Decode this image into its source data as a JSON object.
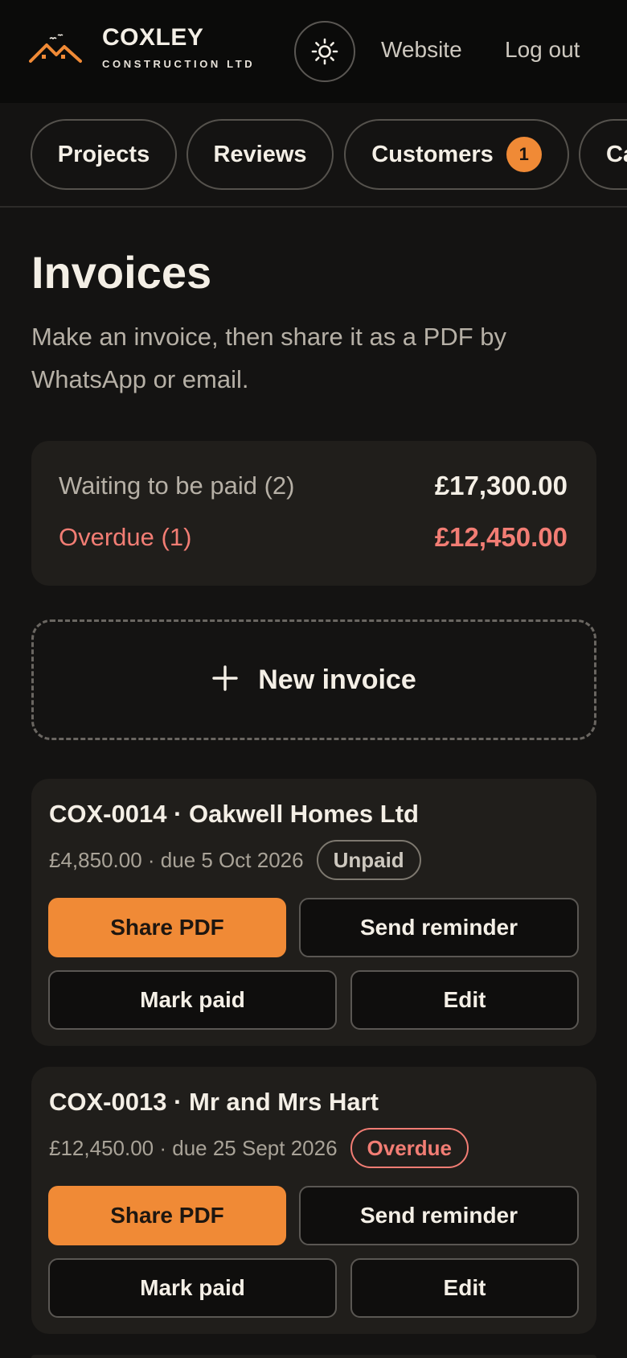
{
  "brand": {
    "name": "COXLEY",
    "tagline": "CONSTRUCTION LTD"
  },
  "header": {
    "theme_icon": "sun-icon",
    "website_label": "Website",
    "logout_label": "Log out"
  },
  "tabs": [
    {
      "label": "Projects"
    },
    {
      "label": "Reviews"
    },
    {
      "label": "Customers",
      "badge": "1"
    },
    {
      "label": "Ca"
    }
  ],
  "page": {
    "title": "Invoices",
    "subtitle": "Make an invoice, then share it as a PDF by WhatsApp or email."
  },
  "summary": {
    "waiting_label": "Waiting to be paid (2)",
    "waiting_value": "£17,300.00",
    "overdue_label": "Overdue (1)",
    "overdue_value": "£12,450.00"
  },
  "new_invoice_label": "New invoice",
  "invoices": [
    {
      "title": "COX-0014 · Oakwell Homes Ltd",
      "meta": "£4,850.00 · due 5 Oct 2026",
      "status": "Unpaid",
      "share_label": "Share PDF",
      "reminder_label": "Send reminder",
      "mark_paid_label": "Mark paid",
      "edit_label": "Edit"
    },
    {
      "title": "COX-0013 · Mr and Mrs Hart",
      "meta": "£12,450.00 · due 25 Sept 2026",
      "status": "Overdue",
      "share_label": "Share PDF",
      "reminder_label": "Send reminder",
      "mark_paid_label": "Mark paid",
      "edit_label": "Edit"
    }
  ],
  "colors": {
    "accent": "#f08a36",
    "overdue": "#f27d74",
    "background": "#141312",
    "card": "#201e1b"
  }
}
